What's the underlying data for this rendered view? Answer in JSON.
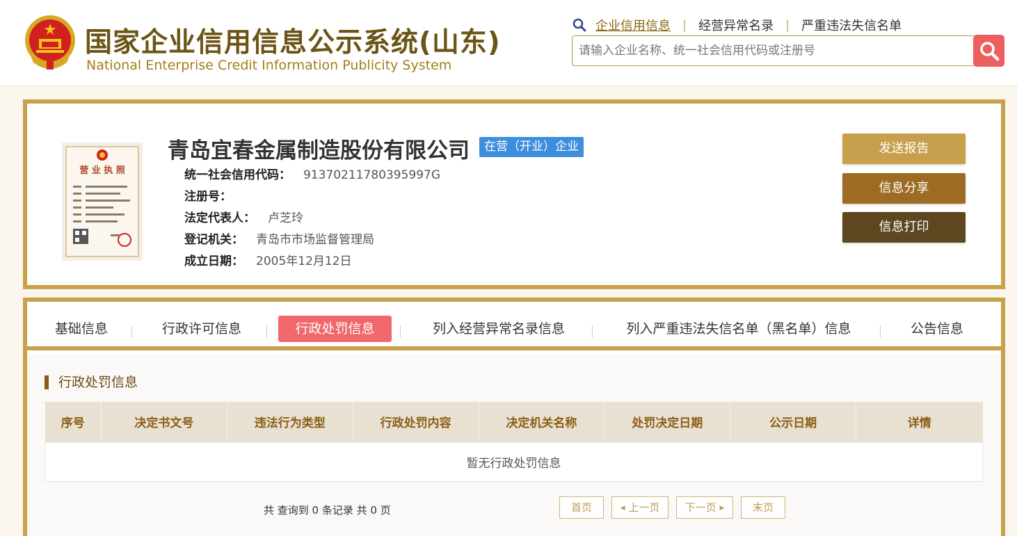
{
  "header": {
    "title_cn": "国家企业信用信息公示系统(山东)",
    "title_en": "National Enterprise Credit Information Publicity System",
    "nav": [
      {
        "label": "企业信用信息",
        "active": true
      },
      {
        "label": "经营异常名录",
        "active": false
      },
      {
        "label": "严重违法失信名单",
        "active": false
      }
    ],
    "search": {
      "placeholder": "请输入企业名称、统一社会信用代码或注册号",
      "value": ""
    }
  },
  "company": {
    "name": "青岛宜春金属制造股份有限公司",
    "status": "在营（开业）企业",
    "fields": [
      {
        "label": "统一社会信用代码：",
        "value": "91370211780395997G"
      },
      {
        "label": "注册号：",
        "value": ""
      },
      {
        "label": "法定代表人：",
        "value": "卢芝玲"
      },
      {
        "label": "登记机关：",
        "value": "青岛市市场监督管理局"
      },
      {
        "label": "成立日期：",
        "value": "2005年12月12日"
      }
    ],
    "license_text": "营 业 执 照",
    "actions": {
      "send": "发送报告",
      "share": "信息分享",
      "print": "信息打印"
    }
  },
  "tabs": [
    {
      "label": "基础信息",
      "active": false
    },
    {
      "label": "行政许可信息",
      "active": false
    },
    {
      "label": "行政处罚信息",
      "active": true
    },
    {
      "label": "列入经营异常名录信息",
      "active": false
    },
    {
      "label": "列入严重违法失信名单（黑名单）信息",
      "active": false
    },
    {
      "label": "公告信息",
      "active": false
    }
  ],
  "section": {
    "title": "行政处罚信息",
    "columns": [
      "序号",
      "决定书文号",
      "违法行为类型",
      "行政处罚内容",
      "决定机关名称",
      "处罚决定日期",
      "公示日期",
      "详情"
    ],
    "empty_text": "暂无行政处罚信息"
  },
  "pager": {
    "info": "共 查询到 0 条记录 共 0 页",
    "first": "首页",
    "prev": "上一页",
    "next": "下一页",
    "last": "末页"
  },
  "colors": {
    "gold_border": "#c9a14b",
    "title_brown": "#6b5416",
    "active_tab": "#f0686b",
    "status_blue": "#3e8ede",
    "search_red": "#ee5f5f"
  }
}
